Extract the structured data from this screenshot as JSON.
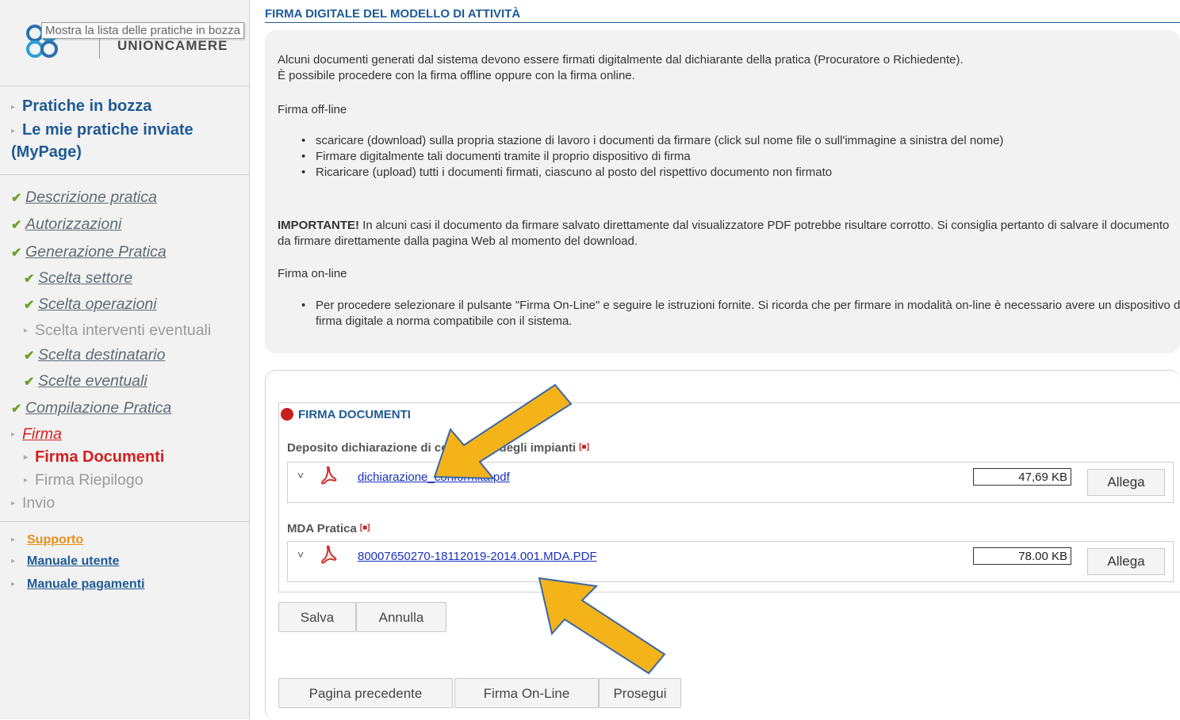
{
  "sidebar": {
    "logo_text": "UNIONCAMERE",
    "tooltip": "Mostra la lista delle pratiche in bozza",
    "main_links": [
      "Pratiche in bozza",
      "Le mie pratiche inviate (MyPage)"
    ],
    "steps": [
      {
        "label": "Descrizione pratica",
        "state": "done"
      },
      {
        "label": "Autorizzazioni",
        "state": "done"
      },
      {
        "label": "Generazione Pratica",
        "state": "done"
      },
      {
        "label": "Scelta settore",
        "state": "done"
      },
      {
        "label": "Scelta operazioni",
        "state": "done"
      },
      {
        "label": "Scelta interventi eventuali",
        "state": "plain"
      },
      {
        "label": "Scelta destinatario",
        "state": "done"
      },
      {
        "label": "Scelte eventuali",
        "state": "done"
      },
      {
        "label": "Compilazione Pratica",
        "state": "done"
      },
      {
        "label": "Firma",
        "state": "active"
      },
      {
        "label": "Firma Documenti",
        "state": "current"
      },
      {
        "label": "Firma Riepilogo",
        "state": "plain"
      },
      {
        "label": "Invio",
        "state": "plain"
      }
    ],
    "support_links": [
      "Supporto",
      "Manuale utente",
      "Manuale pagamenti"
    ],
    "colors": {
      "link": "#1f5a96",
      "active": "#d51e1e",
      "check": "#6aa323",
      "support": "#e8901a"
    }
  },
  "main": {
    "title": "FIRMA DIGITALE DEL MODELLO DI ATTIVITÀ",
    "intro_1": "Alcuni documenti generati dal sistema devono essere firmati digitalmente dal dichiarante della pratica (Procuratore o Richiedente).",
    "intro_2": "È possibile procedere con la firma offline oppure con la firma online.",
    "offline_heading": "Firma off-line",
    "offline_items": [
      "scaricare (download) sulla propria stazione di lavoro i documenti da firmare (click sul nome file o sull'immagine a sinistra del nome)",
      "Firmare digitalmente tali documenti tramite il proprio dispositivo di firma",
      "Ricaricare (upload) tutti i documenti firmati, ciascuno al posto del rispettivo documento non firmato"
    ],
    "important_bold": "IMPORTANTE!",
    "important_text": " In alcuni casi il documento da firmare salvato direttamente dal visualizzatore PDF potrebbe risultare corrotto. Si consiglia pertanto di salvare il documento da firmare direttamente dalla pagina Web al momento del download.",
    "online_heading": "Firma on-line",
    "online_items": [
      "Per procedere selezionare il pulsante \"Firma On-Line\" e seguire le istruzioni fornite. Si ricorda che per firmare in modalità on-line è necessario avere un dispositivo di firma digitale a norma compatibile con il sistema."
    ],
    "docs_heading": "FIRMA DOCUMENTI",
    "groups": [
      {
        "label": "Deposito dichiarazione di conformità degli impianti",
        "flag": "[■]",
        "file": "dichiarazione_conformita.pdf",
        "size": "47,69 KB",
        "attach": "Allega"
      },
      {
        "label": "MDA Pratica",
        "flag": "[■]",
        "file": "80007650270-18112019-2014.001.MDA.PDF",
        "size": "78.00 KB",
        "attach": "Allega"
      }
    ],
    "buttons": {
      "save": "Salva",
      "cancel": "Annulla",
      "prev": "Pagina precedente",
      "online": "Firma On-Line",
      "next": "Prosegui"
    },
    "arrow_color": "#f5b31a"
  }
}
